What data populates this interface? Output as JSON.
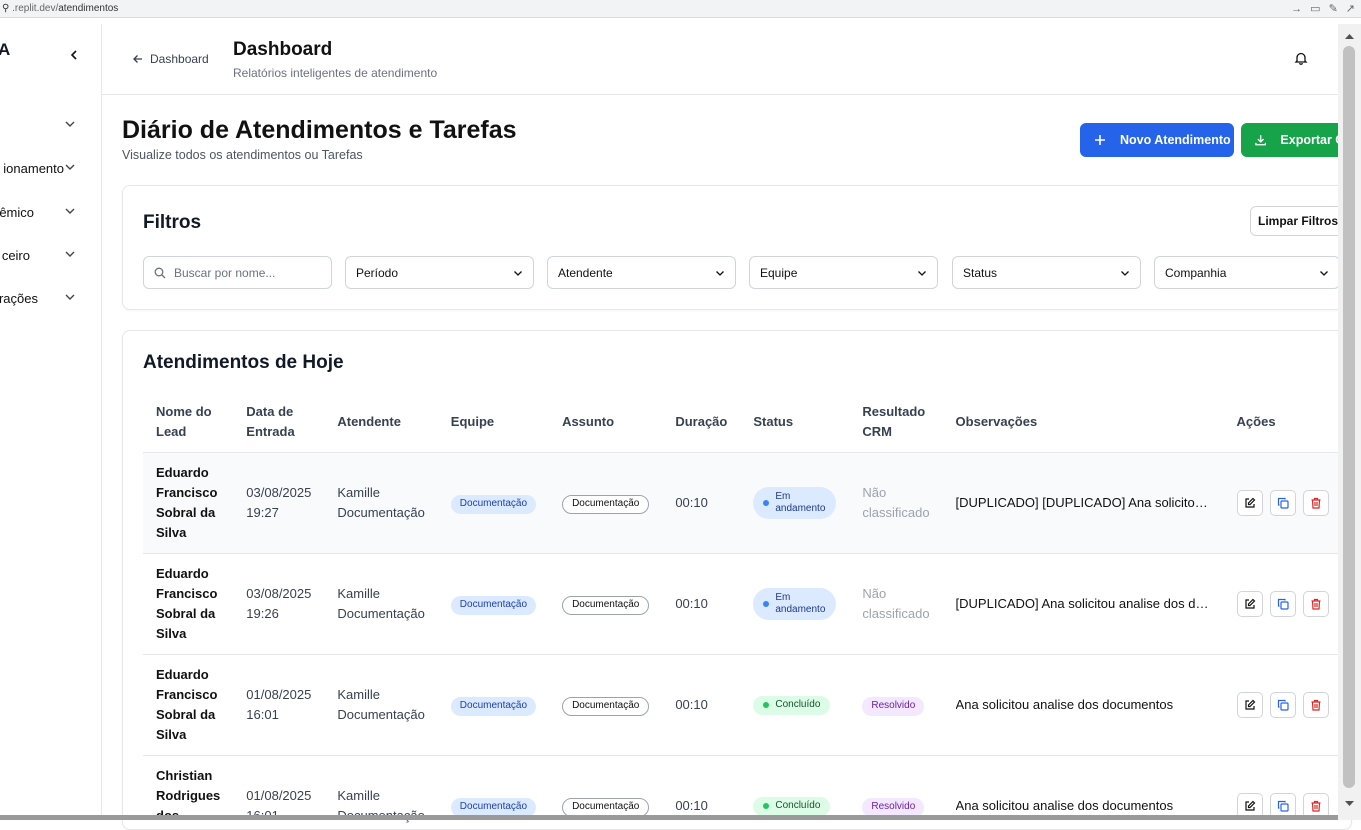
{
  "browser": {
    "host": ".replit.dev/",
    "path": "atendimentos"
  },
  "sidebar": {
    "logo": "A",
    "items": [
      {
        "label": ""
      },
      {
        "label": "ionamento"
      },
      {
        "label": "êmico"
      },
      {
        "label": "ceiro"
      },
      {
        "label": "rações"
      }
    ]
  },
  "header": {
    "back_label": "Dashboard",
    "title": "Dashboard",
    "subtitle": "Relatórios inteligentes de atendimento"
  },
  "page": {
    "title": "Diário de Atendimentos e Tarefas",
    "subtitle": "Visualize todos os atendimentos ou Tarefas",
    "new_button": "Novo Atendimento",
    "export_button": "Exportar CSV"
  },
  "filters": {
    "title": "Filtros",
    "clear_button": "Limpar Filtros",
    "search_placeholder": "Buscar por nome...",
    "period": "Período",
    "attendant": "Atendente",
    "team": "Equipe",
    "status": "Status",
    "company": "Companhia"
  },
  "table": {
    "title": "Atendimentos de Hoje",
    "headers": [
      "Nome do Lead",
      "Data de Entrada",
      "Atendente",
      "Equipe",
      "Assunto",
      "Duração",
      "Status",
      "Resultado CRM",
      "Observações",
      "Ações"
    ],
    "rows": [
      {
        "name": "Eduardo Francisco Sobral da Silva",
        "date": "03/08/2025",
        "time": "19:27",
        "attendant": "Kamille Documentação",
        "team": "Documentação",
        "subject": "Documentação",
        "duration": "00:10",
        "status": "Em andamento",
        "crm": "Não classificado",
        "obs": "[DUPLICADO] [DUPLICADO] Ana solicitou analise dos documentos"
      },
      {
        "name": "Eduardo Francisco Sobral da Silva",
        "date": "03/08/2025",
        "time": "19:26",
        "attendant": "Kamille Documentação",
        "team": "Documentação",
        "subject": "Documentação",
        "duration": "00:10",
        "status": "Em andamento",
        "crm": "Não classificado",
        "obs": "[DUPLICADO] Ana solicitou analise dos documentos"
      },
      {
        "name": "Eduardo Francisco Sobral da Silva",
        "date": "01/08/2025",
        "time": "16:01",
        "attendant": "Kamille Documentação",
        "team": "Documentação",
        "subject": "Documentação",
        "duration": "00:10",
        "status": "Concluído",
        "crm": "Resolvido",
        "obs": "Ana solicitou analise dos documentos"
      },
      {
        "name": "Christian Rodrigues dos Santos",
        "date": "01/08/2025",
        "time": "16:01",
        "attendant": "Kamille Documentação",
        "team": "Documentação",
        "subject": "Documentação",
        "duration": "00:10",
        "status": "Concluído",
        "crm": "Resolvido",
        "obs": "Ana solicitou analise dos documentos"
      }
    ]
  },
  "colors": {
    "primary": "#2563eb",
    "success": "#16a34a",
    "danger": "#dc2626"
  }
}
